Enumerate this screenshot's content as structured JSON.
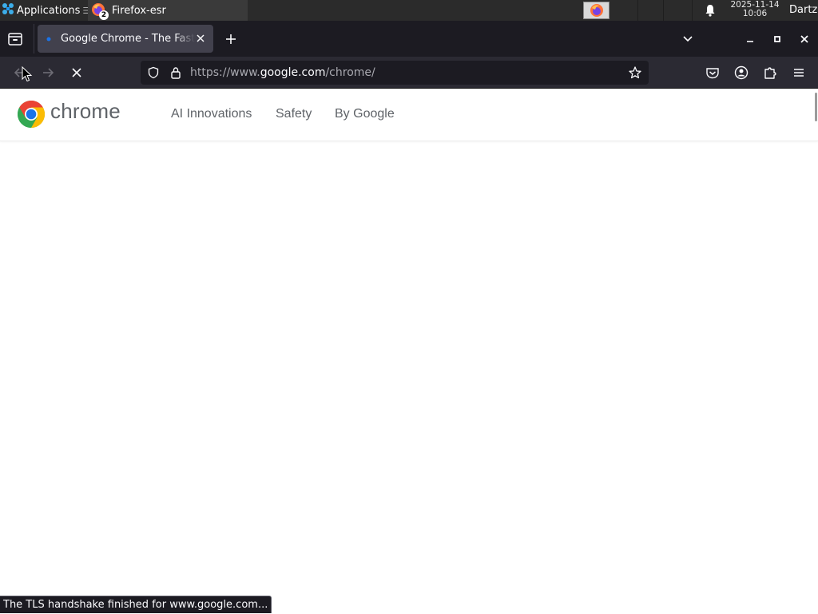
{
  "taskbar": {
    "applications_label": "Applications",
    "task_label": "Firefox-esr",
    "task_badge": "2",
    "clock_date": "2025-11-14",
    "clock_time": "10:06",
    "user": "Dartz"
  },
  "browser": {
    "tab_title": "Google Chrome - The Fast & Secure Web Browser Built to be Yours",
    "url_prefix": "https://www.",
    "url_host": "google.com",
    "url_path": "/chrome/",
    "status_text": "The TLS handshake finished for www.google.com..."
  },
  "page": {
    "brand": "chrome",
    "nav": [
      "AI Innovations",
      "Safety",
      "By Google"
    ]
  },
  "colors": {
    "chrome_red": "#ea4335",
    "chrome_yellow": "#fbbc04",
    "chrome_green": "#34a853",
    "chrome_blue": "#1a73e8"
  }
}
